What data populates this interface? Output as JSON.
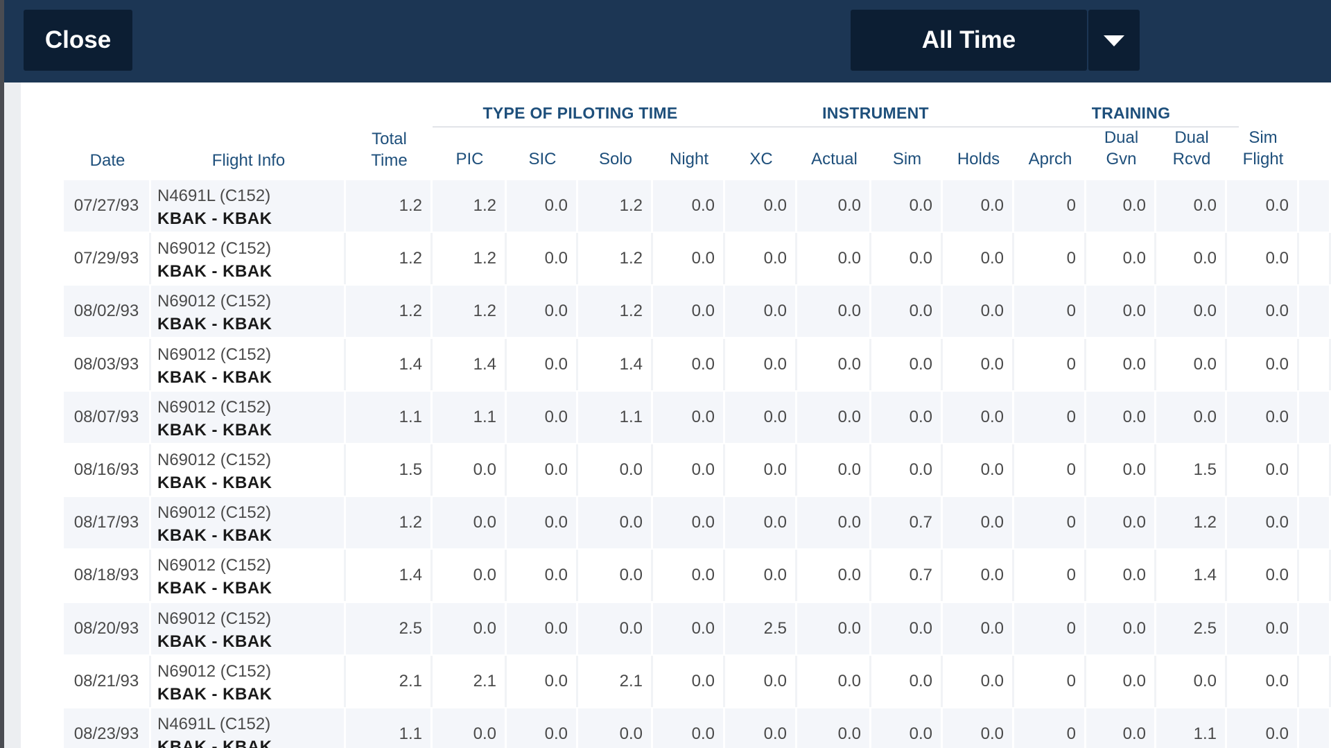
{
  "header": {
    "close_label": "Close",
    "period_label": "All Time",
    "bg_color": "#1c3654",
    "button_color": "#0c1e33"
  },
  "table": {
    "groups": {
      "piloting": "TYPE OF PILOTING TIME",
      "instrument": "INSTRUMENT",
      "training": "TRAINING"
    },
    "columns": {
      "date": "Date",
      "flight_info": "Flight Info",
      "total_time": [
        "Total",
        "Time"
      ],
      "pic": "PIC",
      "sic": "SIC",
      "solo": "Solo",
      "night": "Night",
      "xc": "XC",
      "actual": "Actual",
      "sim": "Sim",
      "holds": "Holds",
      "aprch": "Aprch",
      "dual_gvn": [
        "Dual",
        "Gvn"
      ],
      "dual_rcvd": [
        "Dual",
        "Rcvd"
      ],
      "sim_flight": [
        "Sim",
        "Flight"
      ]
    },
    "rows": [
      {
        "date": "07/27/93",
        "aircraft": "N4691L (C152)",
        "route": "KBAK - KBAK",
        "total": "1.2",
        "pic": "1.2",
        "sic": "0.0",
        "solo": "1.2",
        "night": "0.0",
        "xc": "0.0",
        "actual": "0.0",
        "sim": "0.0",
        "holds": "0.0",
        "aprch": "0",
        "dual_gvn": "0.0",
        "dual_rcvd": "0.0",
        "sim_flight": "0.0"
      },
      {
        "date": "07/29/93",
        "aircraft": "N69012 (C152)",
        "route": "KBAK - KBAK",
        "total": "1.2",
        "pic": "1.2",
        "sic": "0.0",
        "solo": "1.2",
        "night": "0.0",
        "xc": "0.0",
        "actual": "0.0",
        "sim": "0.0",
        "holds": "0.0",
        "aprch": "0",
        "dual_gvn": "0.0",
        "dual_rcvd": "0.0",
        "sim_flight": "0.0"
      },
      {
        "date": "08/02/93",
        "aircraft": "N69012 (C152)",
        "route": "KBAK - KBAK",
        "total": "1.2",
        "pic": "1.2",
        "sic": "0.0",
        "solo": "1.2",
        "night": "0.0",
        "xc": "0.0",
        "actual": "0.0",
        "sim": "0.0",
        "holds": "0.0",
        "aprch": "0",
        "dual_gvn": "0.0",
        "dual_rcvd": "0.0",
        "sim_flight": "0.0"
      },
      {
        "date": "08/03/93",
        "aircraft": "N69012 (C152)",
        "route": "KBAK - KBAK",
        "total": "1.4",
        "pic": "1.4",
        "sic": "0.0",
        "solo": "1.4",
        "night": "0.0",
        "xc": "0.0",
        "actual": "0.0",
        "sim": "0.0",
        "holds": "0.0",
        "aprch": "0",
        "dual_gvn": "0.0",
        "dual_rcvd": "0.0",
        "sim_flight": "0.0"
      },
      {
        "date": "08/07/93",
        "aircraft": "N69012 (C152)",
        "route": "KBAK - KBAK",
        "total": "1.1",
        "pic": "1.1",
        "sic": "0.0",
        "solo": "1.1",
        "night": "0.0",
        "xc": "0.0",
        "actual": "0.0",
        "sim": "0.0",
        "holds": "0.0",
        "aprch": "0",
        "dual_gvn": "0.0",
        "dual_rcvd": "0.0",
        "sim_flight": "0.0"
      },
      {
        "date": "08/16/93",
        "aircraft": "N69012 (C152)",
        "route": "KBAK - KBAK",
        "total": "1.5",
        "pic": "0.0",
        "sic": "0.0",
        "solo": "0.0",
        "night": "0.0",
        "xc": "0.0",
        "actual": "0.0",
        "sim": "0.0",
        "holds": "0.0",
        "aprch": "0",
        "dual_gvn": "0.0",
        "dual_rcvd": "1.5",
        "sim_flight": "0.0"
      },
      {
        "date": "08/17/93",
        "aircraft": "N69012 (C152)",
        "route": "KBAK - KBAK",
        "total": "1.2",
        "pic": "0.0",
        "sic": "0.0",
        "solo": "0.0",
        "night": "0.0",
        "xc": "0.0",
        "actual": "0.0",
        "sim": "0.7",
        "holds": "0.0",
        "aprch": "0",
        "dual_gvn": "0.0",
        "dual_rcvd": "1.2",
        "sim_flight": "0.0"
      },
      {
        "date": "08/18/93",
        "aircraft": "N69012 (C152)",
        "route": "KBAK - KBAK",
        "total": "1.4",
        "pic": "0.0",
        "sic": "0.0",
        "solo": "0.0",
        "night": "0.0",
        "xc": "0.0",
        "actual": "0.0",
        "sim": "0.7",
        "holds": "0.0",
        "aprch": "0",
        "dual_gvn": "0.0",
        "dual_rcvd": "1.4",
        "sim_flight": "0.0"
      },
      {
        "date": "08/20/93",
        "aircraft": "N69012 (C152)",
        "route": "KBAK - KBAK",
        "total": "2.5",
        "pic": "0.0",
        "sic": "0.0",
        "solo": "0.0",
        "night": "0.0",
        "xc": "2.5",
        "actual": "0.0",
        "sim": "0.0",
        "holds": "0.0",
        "aprch": "0",
        "dual_gvn": "0.0",
        "dual_rcvd": "2.5",
        "sim_flight": "0.0"
      },
      {
        "date": "08/21/93",
        "aircraft": "N69012 (C152)",
        "route": "KBAK - KBAK",
        "total": "2.1",
        "pic": "2.1",
        "sic": "0.0",
        "solo": "2.1",
        "night": "0.0",
        "xc": "0.0",
        "actual": "0.0",
        "sim": "0.0",
        "holds": "0.0",
        "aprch": "0",
        "dual_gvn": "0.0",
        "dual_rcvd": "0.0",
        "sim_flight": "0.0"
      },
      {
        "date": "08/23/93",
        "aircraft": "N4691L (C152)",
        "route": "KBAK - KBAK",
        "total": "1.1",
        "pic": "0.0",
        "sic": "0.0",
        "solo": "0.0",
        "night": "0.0",
        "xc": "0.0",
        "actual": "0.0",
        "sim": "0.0",
        "holds": "0.0",
        "aprch": "0",
        "dual_gvn": "0.0",
        "dual_rcvd": "1.1",
        "sim_flight": "0.0"
      }
    ]
  }
}
